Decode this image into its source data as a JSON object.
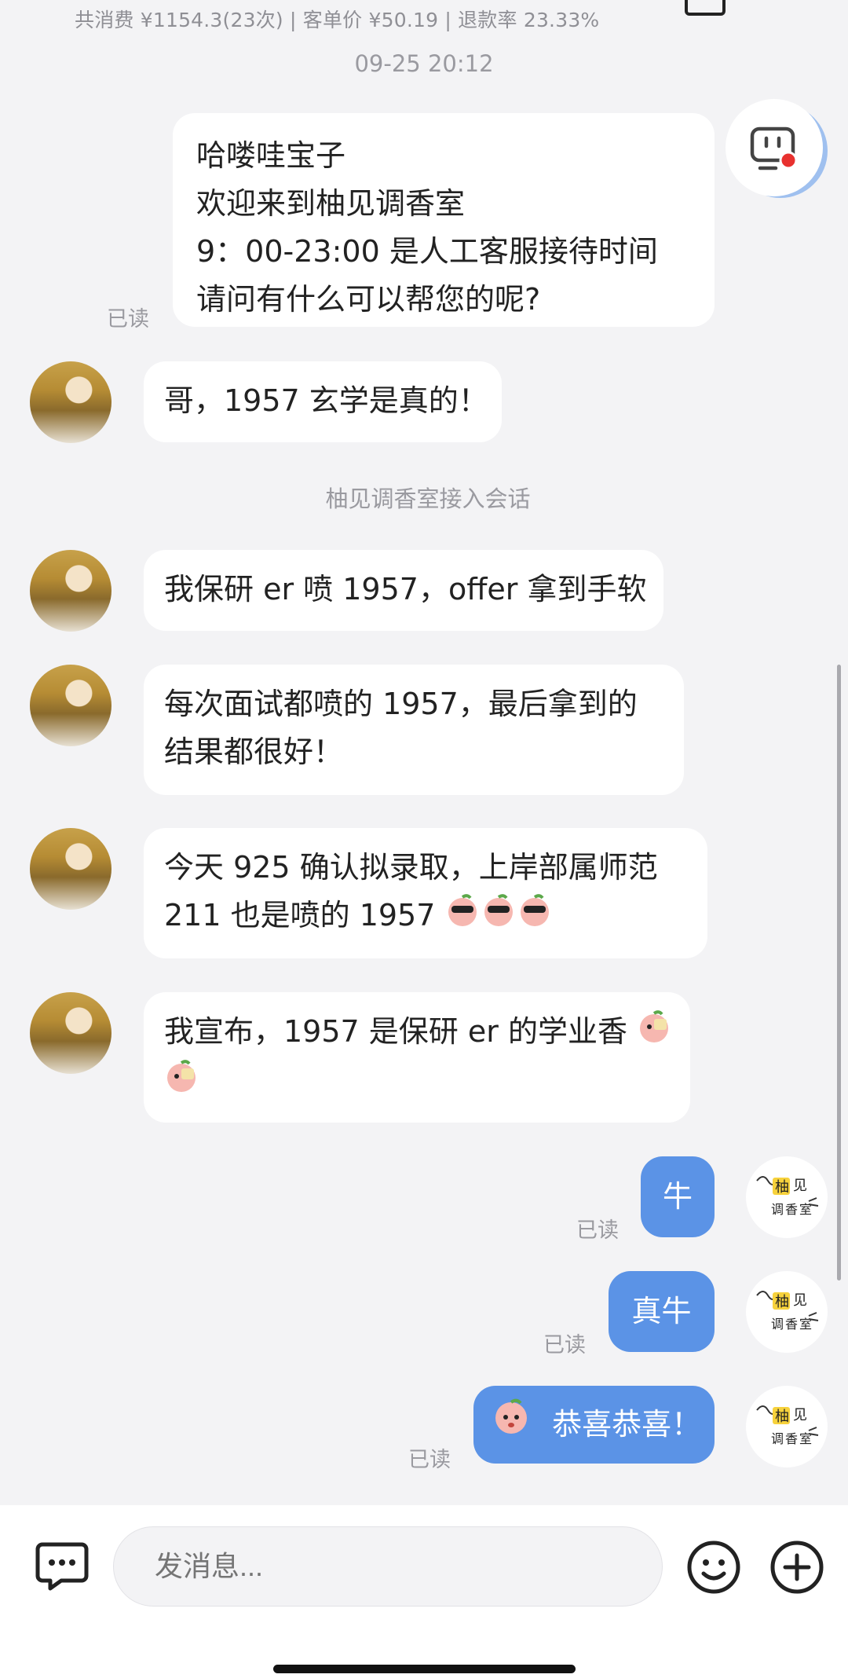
{
  "header": {
    "stats": "共消费 ¥1154.3(23次) | 客单价 ¥50.19 | 退款率 23.33%"
  },
  "timestamp": "09-25 20:12",
  "system_notice": "柚见调香室接入会话",
  "messages": {
    "welcome": [
      "哈喽哇宝子",
      "欢迎来到柚见调香室",
      "9：00-23:00 是人工客服接待时间",
      "请问有什么可以帮您的呢?"
    ],
    "customer_1": "哥，1957 玄学是真的！",
    "customer_2": "我保研 er 喷 1957，offer 拿到手软",
    "customer_3": [
      "每次面试都喷的 1957，最后拿到的",
      "结果都很好！"
    ],
    "customer_4": [
      "今天 925 确认拟录取，上岸部属师范",
      " 211 也是喷的 1957"
    ],
    "customer_5": [
      "我宣布，1957 是保研 er 的学业香"
    ],
    "reply_1": "牛",
    "reply_2": "真牛",
    "reply_3": "恭喜恭喜！"
  },
  "read_label": "已读",
  "shop_avatar_text": [
    "柚",
    "见",
    "调",
    "香",
    "室"
  ],
  "input": {
    "placeholder": "发消息..."
  },
  "icons": {
    "back": "chevron-left-icon",
    "robot": "robot-icon",
    "chat": "chat-bubble-icon",
    "emoji": "smiley-icon",
    "add": "plus-circle-icon"
  },
  "colors": {
    "accent": "#5b93e6",
    "background": "#f3f3f5",
    "bubble": "#ffffff",
    "notice_dot": "#e8312f"
  }
}
